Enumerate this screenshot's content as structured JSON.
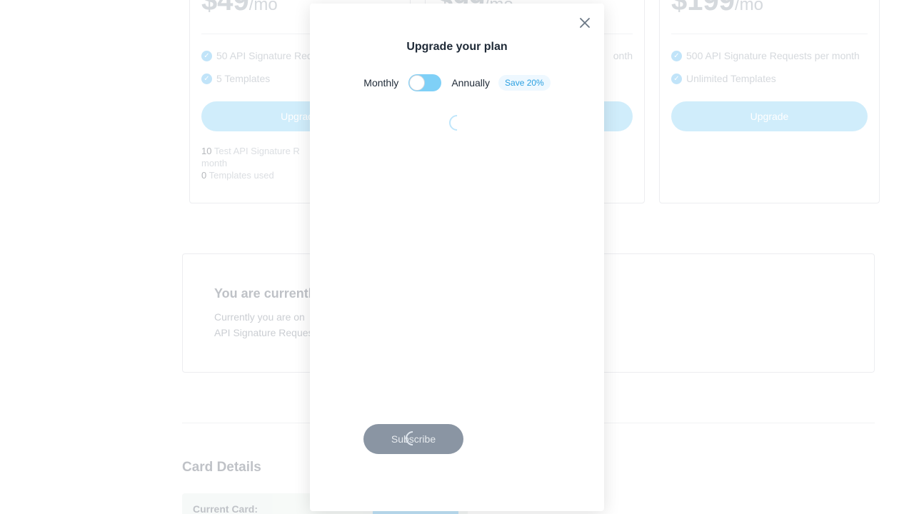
{
  "plans": [
    {
      "price": "$49",
      "per": "/mo",
      "features": [
        "50 API Signature Req",
        "5 Templates"
      ],
      "button": "Upgrade",
      "usage": [
        {
          "num": "10",
          "text": "Test API Signature R"
        },
        {
          "num": "",
          "text": "month"
        },
        {
          "num": "0",
          "text": "Templates used"
        }
      ]
    },
    {
      "price": "$99",
      "per": "/mo",
      "features": [
        "onth"
      ],
      "button": ""
    },
    {
      "price": "$199",
      "per": "/mo",
      "features": [
        "500 API Signature Requests per month",
        "Unlimited Templates"
      ],
      "button": "Upgrade"
    }
  ],
  "current": {
    "title": "You are currentl",
    "line1": "Currently you are on",
    "line2": "API Signature Reques"
  },
  "card_details": {
    "title": "Card Details",
    "current_card_label": "Current Card:"
  },
  "modal": {
    "title": "Upgrade your plan",
    "monthly_label": "Monthly",
    "annually_label": "Annually",
    "save_badge": "Save 20%",
    "subscribe_label": "Subscribe",
    "billing_annually": false
  },
  "colors": {
    "accent": "#4fb3f0",
    "toggle_track": "#7fd0f7",
    "subscribe_bg": "#8a95a3",
    "title_text": "#1f2a37"
  },
  "icons": {
    "close": "close-icon",
    "check": "check-circle-icon",
    "spinner": "loading-spinner-icon"
  }
}
